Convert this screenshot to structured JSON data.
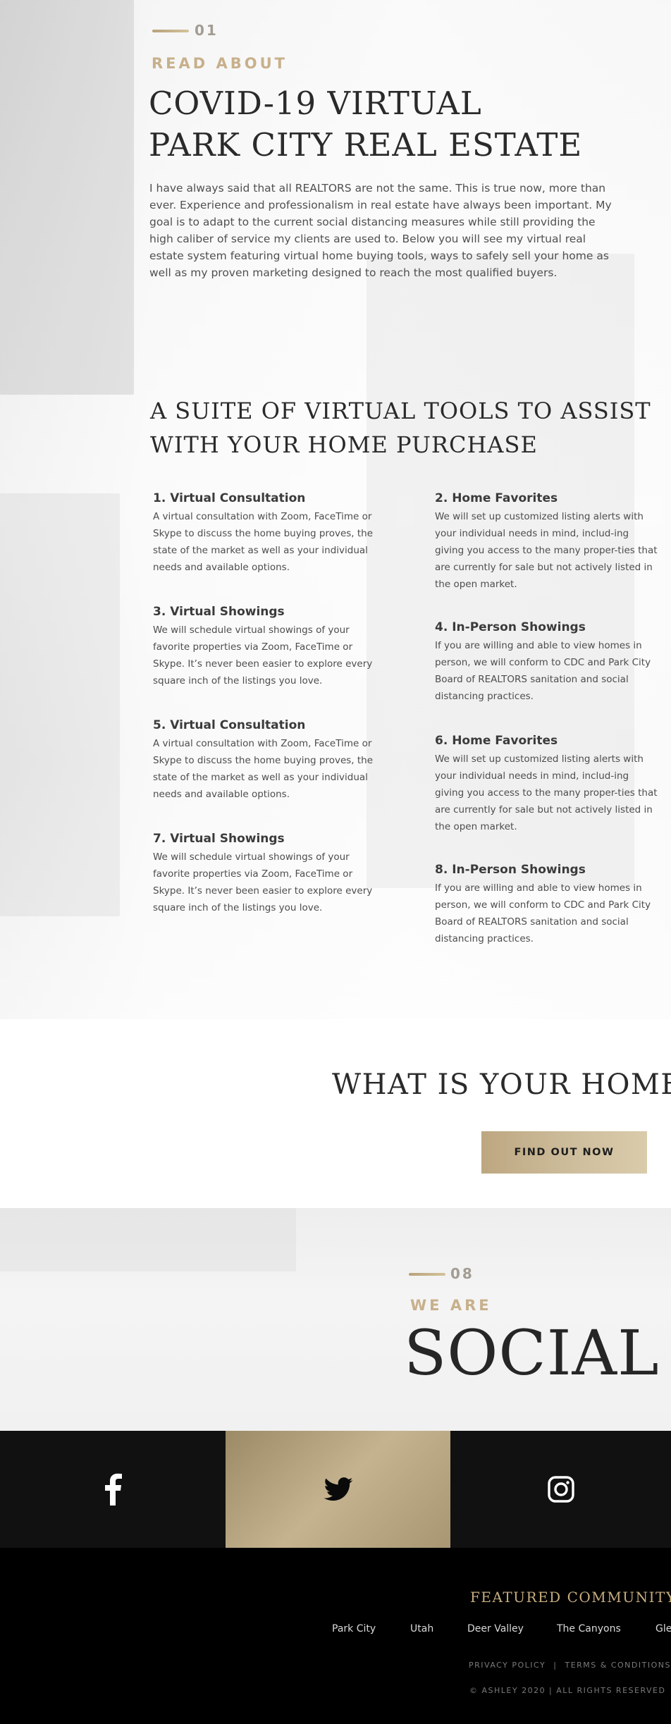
{
  "intro": {
    "number": "01",
    "kicker": "READ ABOUT",
    "title_line1": "COVID-19 VIRTUAL",
    "title_line2": "PARK CITY REAL ESTATE",
    "paragraph": "I have always said that all REALTORS are not the same. This is true now, more than ever. Experience and professionalism in real estate have always been important. My goal is to adapt to the current social distancing measures while still providing the high caliber of service my clients are used to. Below you will see my virtual real estate system featuring virtual home buying tools, ways to safely sell your home as well as my proven marketing designed to reach the most qualified buyers."
  },
  "tools": {
    "title_line1": "A SUITE OF VIRTUAL TOOLS TO ASSIST",
    "title_line2": "WITH YOUR HOME PURCHASE",
    "items": [
      {
        "title": "1. Virtual Consultation",
        "text": "A virtual consultation with Zoom, FaceTime or Skype to discuss the home buying proves, the state of the market as well as your individual needs and available options."
      },
      {
        "title": "2. Home Favorites",
        "text": "We will set up customized listing alerts with your individual needs in mind, includ-ing giving you access to the many proper-ties that are currently for sale but not actively listed in the open market."
      },
      {
        "title": "3. Virtual Showings",
        "text": "We will schedule virtual showings of your favorite properties via Zoom, FaceTime or Skype. It’s never been easier to explore every square inch of the listings you love."
      },
      {
        "title": "4. In-Person Showings",
        "text": "If you are willing and able to view homes in person, we will conform to CDC and Park City Board of REALTORS sanitation and social distancing practices."
      },
      {
        "title": "5. Virtual Consultation",
        "text": "A virtual consultation with Zoom, FaceTime or Skype to discuss the home buying proves, the state of the market as well as your individual needs and available options."
      },
      {
        "title": "6. Home Favorites",
        "text": "We will set up customized listing alerts with your individual needs in mind, includ-ing giving you access to the many proper-ties that are currently for sale but not actively listed in the open market."
      },
      {
        "title": "7. Virtual Showings",
        "text": "We will schedule virtual showings of your favorite properties via Zoom, FaceTime or Skype. It’s never been easier to explore every square inch of the listings you love."
      },
      {
        "title": "8. In-Person Showings",
        "text": "If you are willing and able to view homes in person, we will conform to CDC and Park City Board of REALTORS sanitation and social distancing practices."
      }
    ]
  },
  "valuation": {
    "title": "WHAT IS YOUR HOME W",
    "button_label": "FIND OUT NOW"
  },
  "social": {
    "number": "08",
    "kicker": "WE ARE",
    "title": "SOCIAL",
    "icons": [
      "facebook-icon",
      "twitter-icon",
      "instagram-icon"
    ]
  },
  "footer": {
    "heading": "FEATURED COMMUNITY",
    "links": [
      "Park City",
      "Utah",
      "Deer Valley",
      "The Canyons",
      "Gle"
    ],
    "privacy": "PRIVACY POLICY",
    "separator": "|",
    "terms": "TERMS & CONDITIONS",
    "copyright": "© ASHLEY 2020 | ALL RIGHTS RESERVED"
  },
  "colors": {
    "accent_gold": "#c7b08b",
    "dark": "#111111",
    "footer_bg": "#000000"
  }
}
